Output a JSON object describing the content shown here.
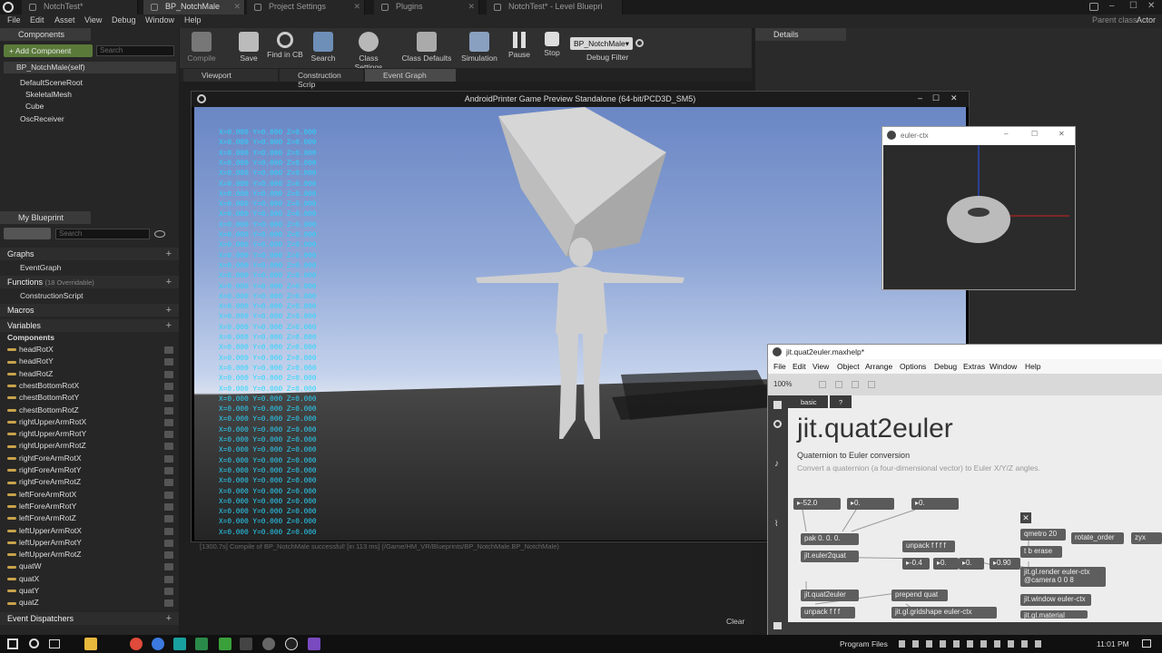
{
  "tabs": [
    {
      "label": "NotchTest*"
    },
    {
      "label": "BP_NotchMale"
    },
    {
      "label": "Project Settings"
    },
    {
      "label": "Plugins"
    },
    {
      "label": "NotchTest* - Level Bluepri"
    }
  ],
  "parent_class_label": "Parent class:",
  "parent_class_value": "Actor",
  "menu": [
    "File",
    "Edit",
    "Asset",
    "View",
    "Debug",
    "Window",
    "Help"
  ],
  "components": {
    "header": "Components",
    "add_button": "+ Add Component",
    "search_placeholder": "Search",
    "self_item": "BP_NotchMale(self)",
    "tree": [
      "DefaultSceneRoot",
      "SkeletalMesh",
      "Cube",
      "OscReceiver"
    ]
  },
  "my_blueprint": {
    "header": "My Blueprint",
    "search_placeholder": "Search",
    "graphs_label": "Graphs",
    "event_graph": "EventGraph",
    "functions_label": "Functions",
    "functions_note": "(18 Overridable)",
    "construction_script": "ConstructionScript",
    "macros_label": "Macros",
    "variables_label": "Variables",
    "components_sub": "Components",
    "variables": [
      "headRotX",
      "headRotY",
      "headRotZ",
      "chestBottomRotX",
      "chestBottomRotY",
      "chestBottomRotZ",
      "rightUpperArmRotX",
      "rightUpperArmRotY",
      "rightUpperArmRotZ",
      "rightForeArmRotX",
      "rightForeArmRotY",
      "rightForeArmRotZ",
      "leftForeArmRotX",
      "leftForeArmRotY",
      "leftForeArmRotZ",
      "leftUpperArmRotX",
      "leftUpperArmRotY",
      "leftUpperArmRotZ",
      "quatW",
      "quatX",
      "quatY",
      "quatZ"
    ],
    "event_dispatchers": "Event Dispatchers"
  },
  "toolbar": {
    "compile": "Compile",
    "save": "Save",
    "find_in_cb": "Find in CB",
    "search": "Search",
    "class_settings": "Class Settings",
    "class_defaults": "Class Defaults",
    "simulation": "Simulation",
    "pause": "Pause",
    "stop": "Stop",
    "debug_object": "BP_NotchMale▾",
    "debug_filter": "Debug Filter"
  },
  "bp_tabs": [
    "Viewport",
    "Construction Scrip",
    "Event Graph"
  ],
  "details_label": "Details",
  "game_window_title": "AndroidPrinter Game Preview Standalone (64-bit/PCD3D_SM5)",
  "xyz_line": "X=0.000 Y=0.000 Z=0.000",
  "xyz_count": 40,
  "console_log": "[1300.7s] Compile of BP_NotchMale successful! [in 113 ms] (/Game/HM_VR/Blueprints/BP_NotchMale.BP_NotchMale)",
  "console_clear": "Clear",
  "euler_title": "euler-ctx",
  "max": {
    "title": "jit.quat2euler.maxhelp*",
    "menu": [
      "File",
      "Edit",
      "View",
      "Object",
      "Arrange",
      "Options",
      "Debug",
      "Extras",
      "Window",
      "Help"
    ],
    "zoom": "100%",
    "tab_basic": "basic",
    "tab_q": "?",
    "heading": "jit.quat2euler",
    "subtitle": "Quaternion to Euler conversion",
    "description": "Convert a quaternion (a four-dimensional vector) to Euler X/Y/Z angles.",
    "num1": "▸-52.0",
    "num2": "▸0.",
    "num3": "▸0.",
    "objs": {
      "pak": "pak 0. 0. 0.",
      "euler2quat": "jit.euler2quat",
      "unpack4": "unpack f f f f",
      "metro": "qmetro 20",
      "rotate_order": "rotate_order",
      "zyx": "zyx",
      "erase": "t b erase",
      "v1": "▸-0.4",
      "v2": "▸0.",
      "v3": "▸0.",
      "v4": "▸0.90",
      "render": "jit.gl.render euler-ctx",
      "camera": "@camera 0 0 8",
      "quat2euler": "jit.quat2euler",
      "prepend": "prepend quat",
      "window": "jit.window euler-ctx",
      "unpack3": "unpack f f f",
      "gridshape": "jit.gl.gridshape euler-ctx",
      "material": "jit.gl.material"
    }
  },
  "taskbar": {
    "program_files": "Program Files",
    "time": "11:01 PM"
  }
}
